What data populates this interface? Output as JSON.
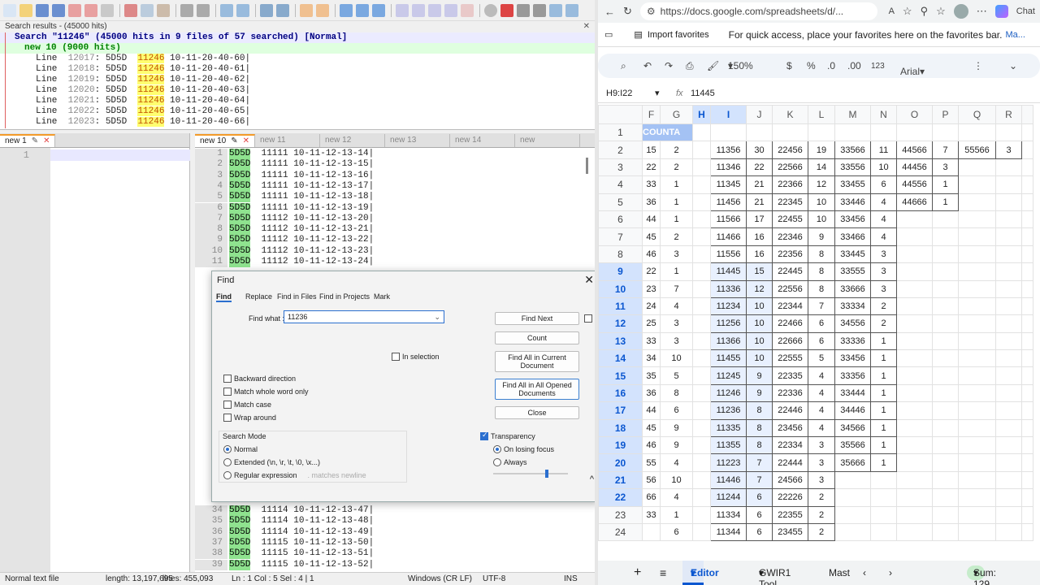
{
  "npp": {
    "search_title": "Search results - (45000 hits)",
    "search_header": "Search \"11246\" (45000 hits in 9 files of 57 searched) [Normal]",
    "search_file": "new 10 (9000 hits)",
    "results": [
      {
        "ln": "12017",
        "pre": ": 5D5D  ",
        "hit": "11246",
        "post": " 10-11-20-40-60|"
      },
      {
        "ln": "12018",
        "pre": ": 5D5D  ",
        "hit": "11246",
        "post": " 10-11-20-40-61|"
      },
      {
        "ln": "12019",
        "pre": ": 5D5D  ",
        "hit": "11246",
        "post": " 10-11-20-40-62|"
      },
      {
        "ln": "12020",
        "pre": ": 5D5D  ",
        "hit": "11246",
        "post": " 10-11-20-40-63|"
      },
      {
        "ln": "12021",
        "pre": ": 5D5D  ",
        "hit": "11246",
        "post": " 10-11-20-40-64|"
      },
      {
        "ln": "12022",
        "pre": ": 5D5D  ",
        "hit": "11246",
        "post": " 10-11-20-40-65|"
      },
      {
        "ln": "12023",
        "pre": ": 5D5D  ",
        "hit": "11246",
        "post": " 10-11-20-40-66|"
      }
    ],
    "left_tab": "new 1",
    "left_line": "1",
    "tabs": [
      "new 10",
      "new 11",
      "new 12",
      "new 13",
      "new 14",
      "new"
    ],
    "code_top": [
      [
        "1",
        "5D5D",
        "  11111 10-11-12-13-14|"
      ],
      [
        "2",
        "5D5D",
        "  11111 10-11-12-13-15|"
      ],
      [
        "3",
        "5D5D",
        "  11111 10-11-12-13-16|"
      ],
      [
        "4",
        "5D5D",
        "  11111 10-11-12-13-17|"
      ],
      [
        "5",
        "5D5D",
        "  11111 10-11-12-13-18|"
      ],
      [
        "6",
        "5D5D",
        "  11111 10-11-12-13-19|"
      ],
      [
        "7",
        "5D5D",
        "  11112 10-11-12-13-20|"
      ],
      [
        "8",
        "5D5D",
        "  11112 10-11-12-13-21|"
      ],
      [
        "9",
        "5D5D",
        "  11112 10-11-12-13-22|"
      ],
      [
        "10",
        "5D5D",
        "  11112 10-11-12-13-23|"
      ],
      [
        "11",
        "5D5D",
        "  11112 10-11-12-13-24|"
      ]
    ],
    "code_bottom": [
      [
        "34",
        "5D5D",
        "  11114 10-11-12-13-47|"
      ],
      [
        "35",
        "5D5D",
        "  11114 10-11-12-13-48|"
      ],
      [
        "36",
        "5D5D",
        "  11114 10-11-12-13-49|"
      ],
      [
        "37",
        "5D5D",
        "  11115 10-11-12-13-50|"
      ],
      [
        "38",
        "5D5D",
        "  11115 10-11-12-13-51|"
      ],
      [
        "39",
        "5D5D",
        "  11115 10-11-12-13-52|"
      ]
    ],
    "status": {
      "type": "Normal text file",
      "length": "length: 13,197,695",
      "lines": "lines: 455,093",
      "pos": "Ln : 1    Col : 5    Sel : 4 | 1",
      "eol": "Windows (CR LF)",
      "enc": "UTF-8",
      "mode": "INS"
    }
  },
  "find": {
    "title": "Find",
    "tabs": [
      "Find",
      "Replace",
      "Find in Files",
      "Find in Projects",
      "Mark"
    ],
    "find_label": "Find what :",
    "find_value": "11236",
    "in_selection": "In selection",
    "buttons": [
      "Find Next",
      "Count",
      "Find All in Current Document",
      "Find All in All Opened Documents",
      "Close"
    ],
    "options": [
      "Backward direction",
      "Match whole word only",
      "Match case",
      "Wrap around"
    ],
    "search_mode": "Search Mode",
    "modes": [
      "Normal",
      "Extended (\\n, \\r, \\t, \\0, \\x...)",
      "Regular expression"
    ],
    "matches_newline": ". matches newline",
    "transparency": "Transparency",
    "trans_opts": [
      "On losing focus",
      "Always"
    ]
  },
  "chrome": {
    "url": "https://docs.google.com/spreadsheets/d/...",
    "import_fav": "Import favorites",
    "fav_msg": "For quick access, place your favorites here on the favorites bar.",
    "manage": "Ma...",
    "chat": "Chat"
  },
  "sheet": {
    "zoom": "150%",
    "currency": "$",
    "percent": "%",
    "dec_dec": ".0",
    "dec_inc": ".00",
    "fmt": "123",
    "font": "Arial",
    "namebox": "H9:I22",
    "formula": "11445",
    "cols": [
      "",
      "F",
      "G",
      "H",
      "I",
      "J",
      "K",
      "L",
      "M",
      "N",
      "O",
      "P",
      "Q",
      "R"
    ],
    "header_text": "COUNTA",
    "rows": [
      [
        "2",
        "15",
        "2",
        "",
        "11356",
        "30",
        "22456",
        "19",
        "33566",
        "11",
        "44566",
        "7",
        "55566",
        "3"
      ],
      [
        "3",
        "22",
        "2",
        "",
        "11346",
        "22",
        "22566",
        "14",
        "33556",
        "10",
        "44456",
        "3",
        "",
        ""
      ],
      [
        "4",
        "33",
        "1",
        "",
        "11345",
        "21",
        "22366",
        "12",
        "33455",
        "6",
        "44556",
        "1",
        "",
        ""
      ],
      [
        "5",
        "36",
        "1",
        "",
        "11456",
        "21",
        "22345",
        "10",
        "33446",
        "4",
        "44666",
        "1",
        "",
        ""
      ],
      [
        "6",
        "44",
        "1",
        "",
        "11566",
        "17",
        "22455",
        "10",
        "33456",
        "4",
        "",
        "",
        "",
        ""
      ],
      [
        "7",
        "45",
        "2",
        "",
        "11466",
        "16",
        "22346",
        "9",
        "33466",
        "4",
        "",
        "",
        "",
        ""
      ],
      [
        "8",
        "46",
        "3",
        "",
        "11556",
        "16",
        "22356",
        "8",
        "33445",
        "3",
        "",
        "",
        "",
        ""
      ],
      [
        "9",
        "22",
        "1",
        "",
        "11445",
        "15",
        "22445",
        "8",
        "33555",
        "3",
        "",
        "",
        "",
        ""
      ],
      [
        "10",
        "23",
        "7",
        "",
        "11336",
        "12",
        "22556",
        "8",
        "33666",
        "3",
        "",
        "",
        "",
        ""
      ],
      [
        "11",
        "24",
        "4",
        "",
        "11234",
        "10",
        "22344",
        "7",
        "33334",
        "2",
        "",
        "",
        "",
        ""
      ],
      [
        "12",
        "25",
        "3",
        "",
        "11256",
        "10",
        "22466",
        "6",
        "34556",
        "2",
        "",
        "",
        "",
        ""
      ],
      [
        "13",
        "33",
        "3",
        "",
        "11366",
        "10",
        "22666",
        "6",
        "33336",
        "1",
        "",
        "",
        "",
        ""
      ],
      [
        "14",
        "34",
        "10",
        "",
        "11455",
        "10",
        "22555",
        "5",
        "33456",
        "1",
        "",
        "",
        "",
        ""
      ],
      [
        "15",
        "35",
        "5",
        "",
        "11245",
        "9",
        "22335",
        "4",
        "33356",
        "1",
        "",
        "",
        "",
        ""
      ],
      [
        "16",
        "36",
        "8",
        "",
        "11246",
        "9",
        "22336",
        "4",
        "33444",
        "1",
        "",
        "",
        "",
        ""
      ],
      [
        "17",
        "44",
        "6",
        "",
        "11236",
        "8",
        "22446",
        "4",
        "34446",
        "1",
        "",
        "",
        "",
        ""
      ],
      [
        "18",
        "45",
        "9",
        "",
        "11335",
        "8",
        "23456",
        "4",
        "34566",
        "1",
        "",
        "",
        "",
        ""
      ],
      [
        "19",
        "46",
        "9",
        "",
        "11355",
        "8",
        "22334",
        "3",
        "35566",
        "1",
        "",
        "",
        "",
        ""
      ],
      [
        "20",
        "55",
        "4",
        "",
        "11223",
        "7",
        "22444",
        "3",
        "35666",
        "1",
        "",
        "",
        "",
        ""
      ],
      [
        "21",
        "56",
        "10",
        "",
        "11446",
        "7",
        "24566",
        "3",
        "",
        "",
        "",
        "",
        "",
        ""
      ],
      [
        "22",
        "66",
        "4",
        "",
        "11244",
        "6",
        "22226",
        "2",
        "",
        "",
        "",
        "",
        "",
        ""
      ],
      [
        "23",
        "33",
        "1",
        "",
        "11334",
        "6",
        "22355",
        "2",
        "",
        "",
        "",
        "",
        "",
        ""
      ],
      [
        "24",
        "",
        "6",
        "",
        "11344",
        "6",
        "23455",
        "2",
        "",
        "",
        "",
        "",
        "",
        ""
      ]
    ],
    "sheet_tabs": [
      "Editor",
      "GWIR1 Tool",
      "Mast"
    ],
    "sum": "Sum: 129"
  }
}
